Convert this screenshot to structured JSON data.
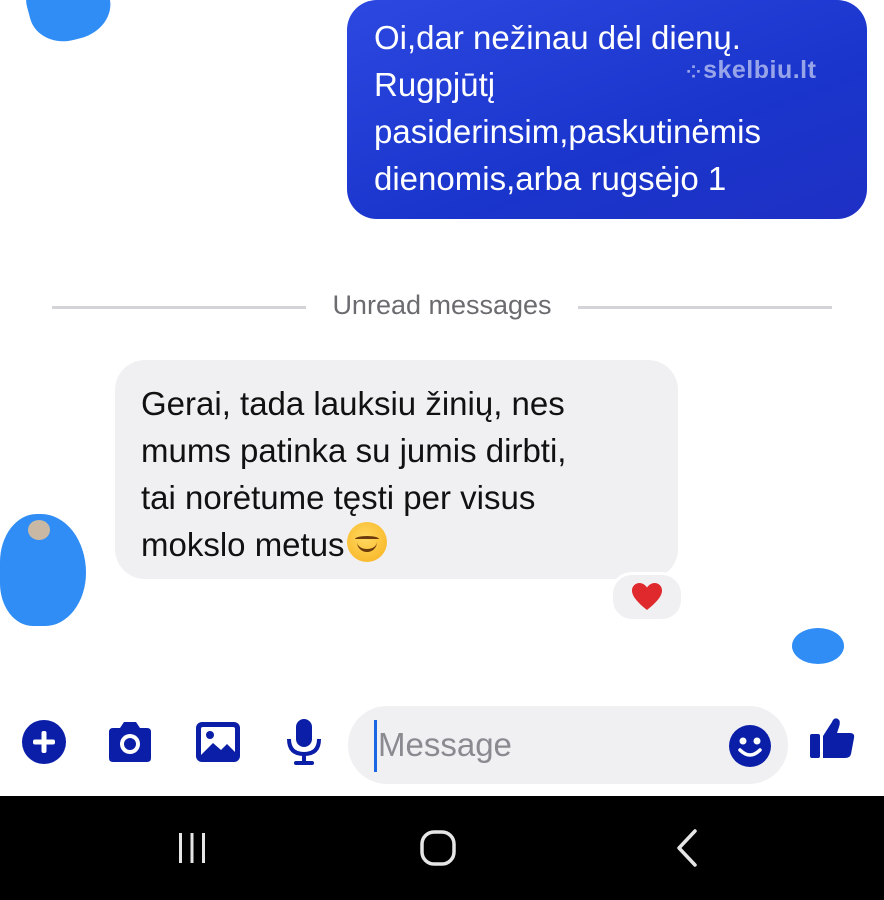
{
  "outgoing_message": {
    "lines": [
      "Oi,dar nežinau dėl dienų.",
      "Rugpjūtį",
      "pasiderinsim,paskutinėmis",
      "dienomis,arba rugsėjo 1"
    ]
  },
  "watermark": {
    "text": "skelbiu.lt"
  },
  "divider": {
    "label": "Unread messages"
  },
  "incoming_message": {
    "lines": [
      "Gerai, tada lauksiu žinių, nes",
      "mums patinka su jumis dirbti,",
      "tai norėtume tęsti per visus",
      "mokslo metus"
    ],
    "trailing_emoji": "smiling-face-with-smiling-eyes",
    "reaction": "heart"
  },
  "composer": {
    "placeholder": "Message",
    "tools": [
      "plus-icon",
      "camera-icon",
      "image-icon",
      "microphone-icon"
    ],
    "emoji_icon": "emoji-icon",
    "send_icon": "thumbs-up-icon"
  },
  "system_nav": {
    "buttons": [
      "recent-apps-icon",
      "home-icon",
      "back-icon"
    ]
  },
  "colors": {
    "accent": "#1a35cc",
    "outgoing_bubble": "#2341d9",
    "incoming_bubble": "#f0f0f3",
    "toolbar_icon": "#0a1ea8",
    "caret": "#1b66e3",
    "redaction": "#2f8df5",
    "heart": "#e0292c"
  }
}
